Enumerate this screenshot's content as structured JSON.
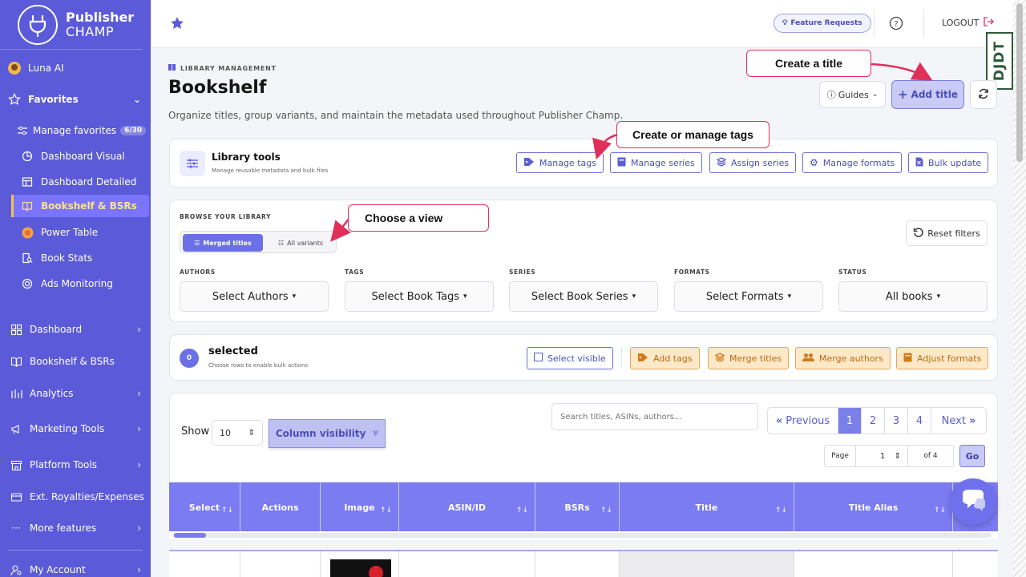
{
  "brand": {
    "line1": "Publisher",
    "line2": "CHAMP"
  },
  "sidebar": {
    "user": "Luna AI",
    "favorites_label": "Favorites",
    "favorites": [
      {
        "label": "Manage favorites",
        "badge": "6/30"
      },
      {
        "label": "Dashboard Visual"
      },
      {
        "label": "Dashboard Detailed"
      },
      {
        "label": "Bookshelf & BSRs"
      },
      {
        "label": "Power Table"
      },
      {
        "label": "Book Stats"
      },
      {
        "label": "Ads Monitoring"
      }
    ],
    "main": [
      {
        "label": "Dashboard"
      },
      {
        "label": "Bookshelf & BSRs"
      },
      {
        "label": "Analytics"
      },
      {
        "label": "Marketing Tools"
      },
      {
        "label": "Platform Tools"
      },
      {
        "label": "Ext. Royalties/Expenses"
      },
      {
        "label": "More features"
      },
      {
        "label": "My Account"
      }
    ]
  },
  "topbar": {
    "feature_requests": "Feature Requests",
    "logout": "LOGOUT"
  },
  "debug_toolbar": "DJDT",
  "header": {
    "eyebrow": "LIBRARY MANAGEMENT",
    "title": "Bookshelf",
    "subtitle": "Organize titles, group variants, and maintain the metadata used throughout Publisher Champ.",
    "guides": "Guides",
    "add_title": "Add title"
  },
  "tools": {
    "title": "Library tools",
    "subtitle": "Manage reusable metadata and bulk files",
    "buttons": [
      "Manage tags",
      "Manage series",
      "Assign series",
      "Manage formats",
      "Bulk update"
    ]
  },
  "browse": {
    "eyebrow": "BROWSE YOUR LIBRARY",
    "merged": "Merged titles",
    "variants": "All variants",
    "reset": "Reset filters",
    "filters": [
      {
        "label": "AUTHORS",
        "value": "Select Authors"
      },
      {
        "label": "TAGS",
        "value": "Select Book Tags"
      },
      {
        "label": "SERIES",
        "value": "Select Book Series"
      },
      {
        "label": "FORMATS",
        "value": "Select Formats"
      },
      {
        "label": "STATUS",
        "value": "All books"
      }
    ]
  },
  "selection": {
    "count": "0",
    "title": "selected",
    "subtitle": "Choose rows to enable bulk actions",
    "select_visible": "Select visible",
    "actions": [
      "Add tags",
      "Merge titles",
      "Merge authors",
      "Adjust formats"
    ]
  },
  "table_controls": {
    "show": "Show",
    "page_size": "10",
    "column_visibility": "Column visibility",
    "search_placeholder": "Search titles, ASINs, authors...",
    "previous": "Previous",
    "pages": [
      "1",
      "2",
      "3",
      "4"
    ],
    "next": "Next",
    "page_label": "Page",
    "page_value": "1",
    "of_label": "of 4",
    "go": "Go"
  },
  "table": {
    "columns": [
      "Select",
      "Actions",
      "Image",
      "ASIN/ID",
      "BSRs",
      "Title",
      "Title Alias"
    ]
  },
  "callouts": {
    "create_title": "Create a title",
    "manage_tags": "Create or manage tags",
    "choose_view": "Choose a view"
  },
  "colors": {
    "sidebar": "#5b5bd9",
    "accent": "#7b7bf2",
    "callout_border": "#e0305a",
    "warm": "#fde9c8"
  }
}
